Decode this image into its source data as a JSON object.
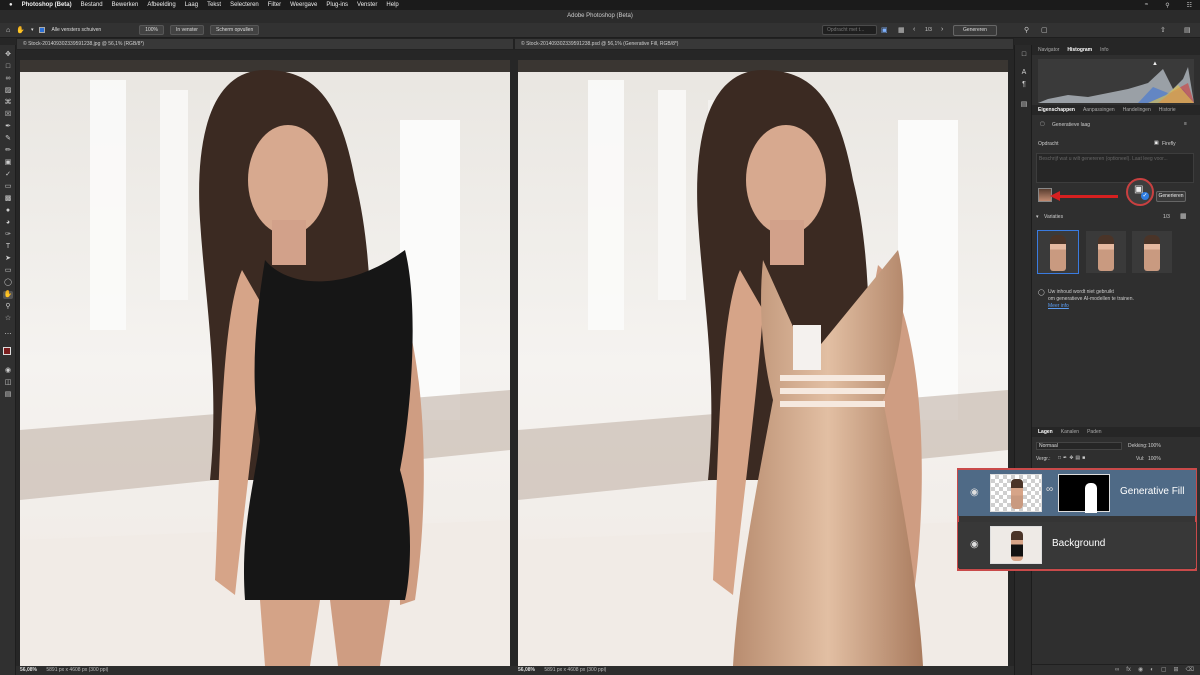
{
  "menubar": {
    "apple": "",
    "items": [
      "Photoshop (Beta)",
      "Bestand",
      "Bewerken",
      "Afbeelding",
      "Laag",
      "Tekst",
      "Selecteren",
      "Filter",
      "Weergave",
      "Plug-ins",
      "Venster",
      "Help"
    ]
  },
  "window": {
    "title": "Adobe Photoshop (Beta)"
  },
  "options": {
    "scroll_all_label": "Alle vensters schuiven",
    "zoom_100": "100%",
    "fit_screen": "In venster",
    "fill_screen": "Scherm opvullen",
    "prompt_placeholder": "Opdracht met t...",
    "variation_counter": "1/3",
    "generate_label": "Genereren"
  },
  "documents": [
    {
      "tab": "© Stock-20140930233959123​8.jpg @ 56,1% (RGB/8*)",
      "zoom": "56,08%",
      "info": "5891 px x 4608 px (300 ppi)"
    },
    {
      "tab": "© Stock-20140930233959123​8.psd @ 56,1% (Generative Fill, RGB/8*)",
      "zoom": "56,08%",
      "info": "5891 px x 4608 px (300 ppi)"
    }
  ],
  "panels": {
    "top_tabs": [
      "Navigator",
      "Histogram",
      "Info"
    ],
    "top_active": "Histogram",
    "prop_tabs": [
      "Eigenschappen",
      "Aanpassingen",
      "Handelingen",
      "Historie"
    ],
    "prop_active": "Eigenschappen",
    "layer_type": "Generatieve laag",
    "prompt_label": "Opdracht",
    "model_label": "Firefly",
    "prompt_placeholder": "Beschrijf wat u wilt genereren (optioneel). Laat leeg voor...",
    "generate_label": "Generieren",
    "variations_label": "Variaties",
    "variations_count": "1/3",
    "disclaimer_1": "Uw inhoud wordt niet gebruikt",
    "disclaimer_2": "om generatieve AI-modellen te trainen.",
    "learn_more": "Meer info",
    "layer_tabs": [
      "Lagen",
      "Kanalen",
      "Paden"
    ],
    "layer_active": "Lagen",
    "blend_mode": "Normaal",
    "opacity_label": "Dekking:",
    "opacity_value": "100%",
    "lock_label": "Vergr.:",
    "fill_label": "Vul:",
    "fill_value": "100%"
  },
  "layers": [
    {
      "name": "Generative Fill",
      "selected": true,
      "visible": true
    },
    {
      "name": "Background",
      "selected": false,
      "visible": true
    }
  ],
  "colors": {
    "accent": "#3a7be0",
    "highlight_red": "#c94a4a",
    "arrow_red": "#d62020",
    "selected_layer": "#4f6a86"
  }
}
